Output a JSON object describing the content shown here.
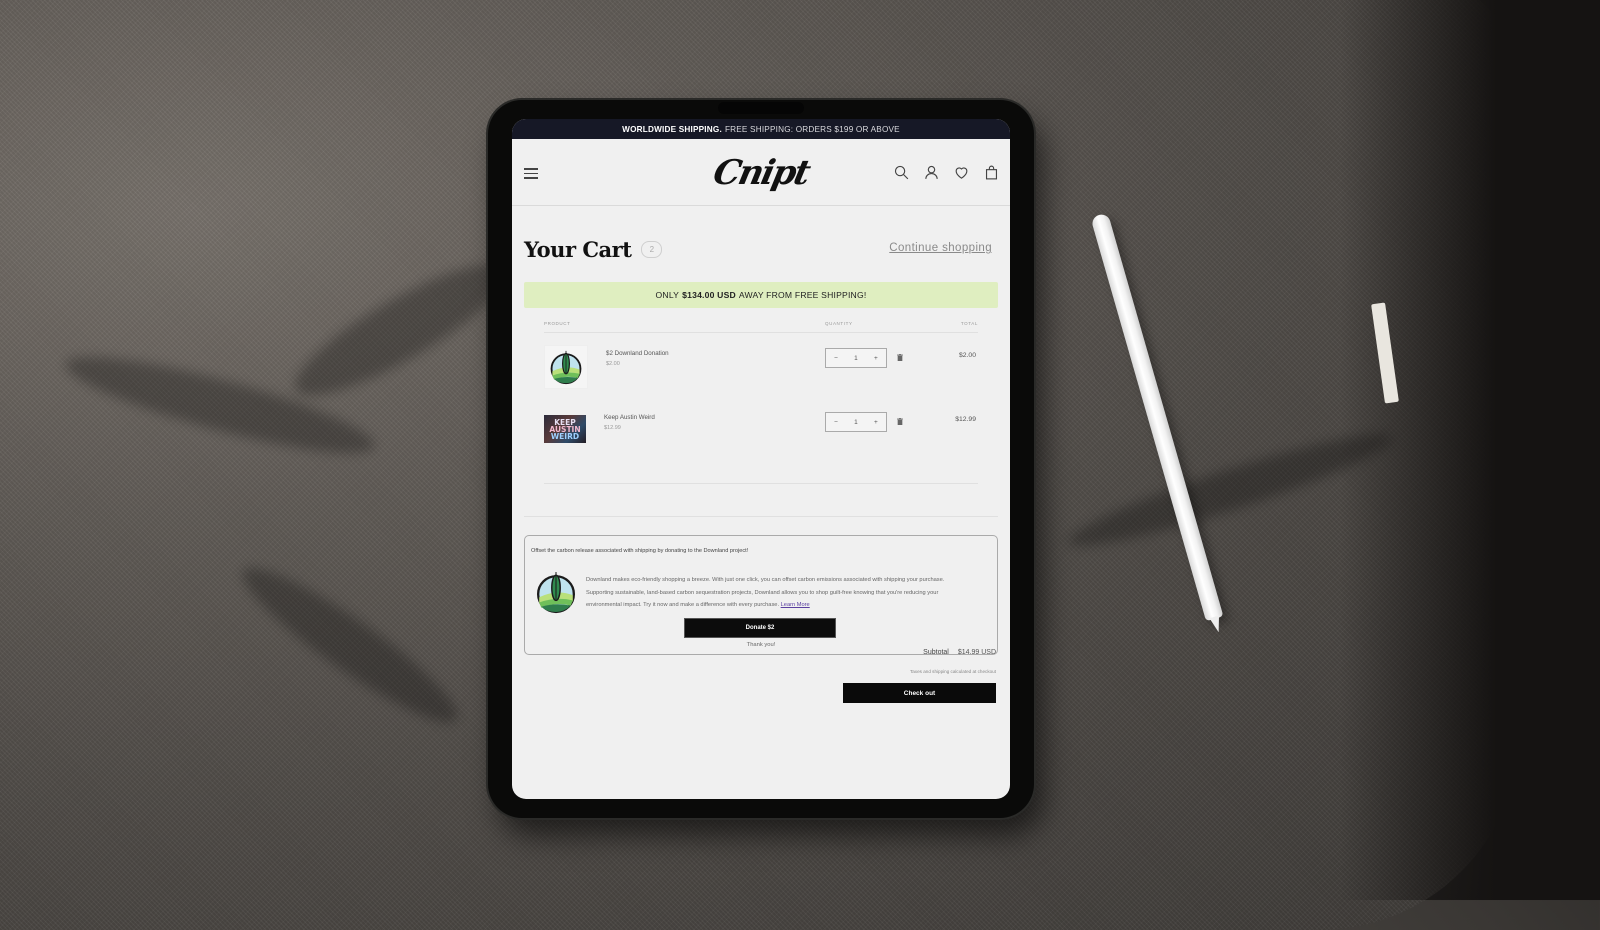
{
  "announcement": {
    "bold": "WORLDWIDE SHIPPING.",
    "text": "FREE SHIPPING: ORDERS $199 OR ABOVE"
  },
  "header": {
    "logo": "Cnipt",
    "icons": [
      "search-icon",
      "account-icon",
      "wishlist-heart-icon",
      "cart-bag-icon"
    ]
  },
  "cart": {
    "title": "Your Cart",
    "count": "2",
    "continue_label": "Continue shopping",
    "shipping_bar": {
      "prefix": "ONLY",
      "amount": "$134.00 USD",
      "suffix": "AWAY FROM FREE SHIPPING!"
    },
    "columns": {
      "product": "PRODUCT",
      "quantity": "QUANTITY",
      "total": "TOTAL"
    },
    "items": [
      {
        "name": "$2 Downland Donation",
        "price": "$2.00",
        "quantity": "1",
        "total": "$2.00",
        "thumb": "downland-logo"
      },
      {
        "name": "Keep Austin Weird",
        "price": "$12.99",
        "quantity": "1",
        "total": "$12.99",
        "thumb": "keep-austin-weird-image",
        "thumb_text": [
          "KEEP",
          "AUSTIN",
          "WEIRD"
        ]
      }
    ],
    "qty_minus": "−",
    "qty_plus": "+"
  },
  "donation": {
    "heading": "Offset the carbon release associated with shipping by donating to the Downland project!",
    "body": "Downland makes eco-friendly shopping a breeze. With just one click, you can offset carbon emissions associated with shipping your purchase. Supporting sustainable, land-based carbon sequestration projects, Downland allows you to shop guilt-free knowing that you're reducing your environmental impact. Try it now and make a difference with every purchase.",
    "learn_more": "Learn More",
    "button": "Donate $2",
    "thanks": "Thank you!"
  },
  "summary": {
    "subtotal_label": "Subtotal",
    "subtotal_value": "$14.99 USD",
    "tax_note": "Taxes and shipping calculated at checkout",
    "checkout_label": "Check out"
  }
}
